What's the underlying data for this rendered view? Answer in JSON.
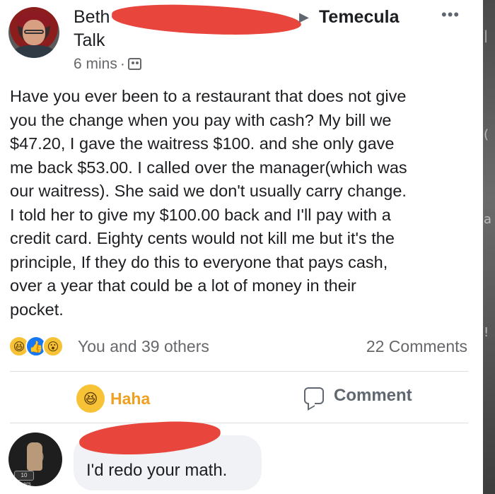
{
  "post": {
    "author_first": "Beth",
    "author_second_line": "Talk",
    "location": "Temecula",
    "more_icon": "more-horizontal-icon",
    "time": "6 mins",
    "audience_icon": "group-icon",
    "body_lines": [
      "Have you ever been to a restaurant that does not give",
      "you the change when you pay with cash? My bill we",
      "$47.20, I gave the waitress $100. and she only gave",
      "me back $53.00. I called over the manager(which was",
      "our waitress). She said we don't usually carry change.",
      "I told her to give my $100.00 back and I'll pay with a",
      "credit card. Eighty cents would not kill me but it's the",
      "principle, If they do this to everyone that pays cash,",
      "over a year that could be a lot of money in their",
      "pocket."
    ]
  },
  "reactions": {
    "icons": [
      "haha-icon",
      "like-icon",
      "wow-icon"
    ],
    "text": "You and 39 others",
    "comments_count": "22 Comments"
  },
  "actions": {
    "haha_label": "Haha",
    "comment_label": "Comment"
  },
  "comment": {
    "text": "I'd redo your math.",
    "avatar_badge": "10 years"
  },
  "colors": {
    "redaction": "#e8453c",
    "haha_active": "#f0a020",
    "meta_gray": "#65676b",
    "bubble_bg": "#f0f2f5"
  }
}
